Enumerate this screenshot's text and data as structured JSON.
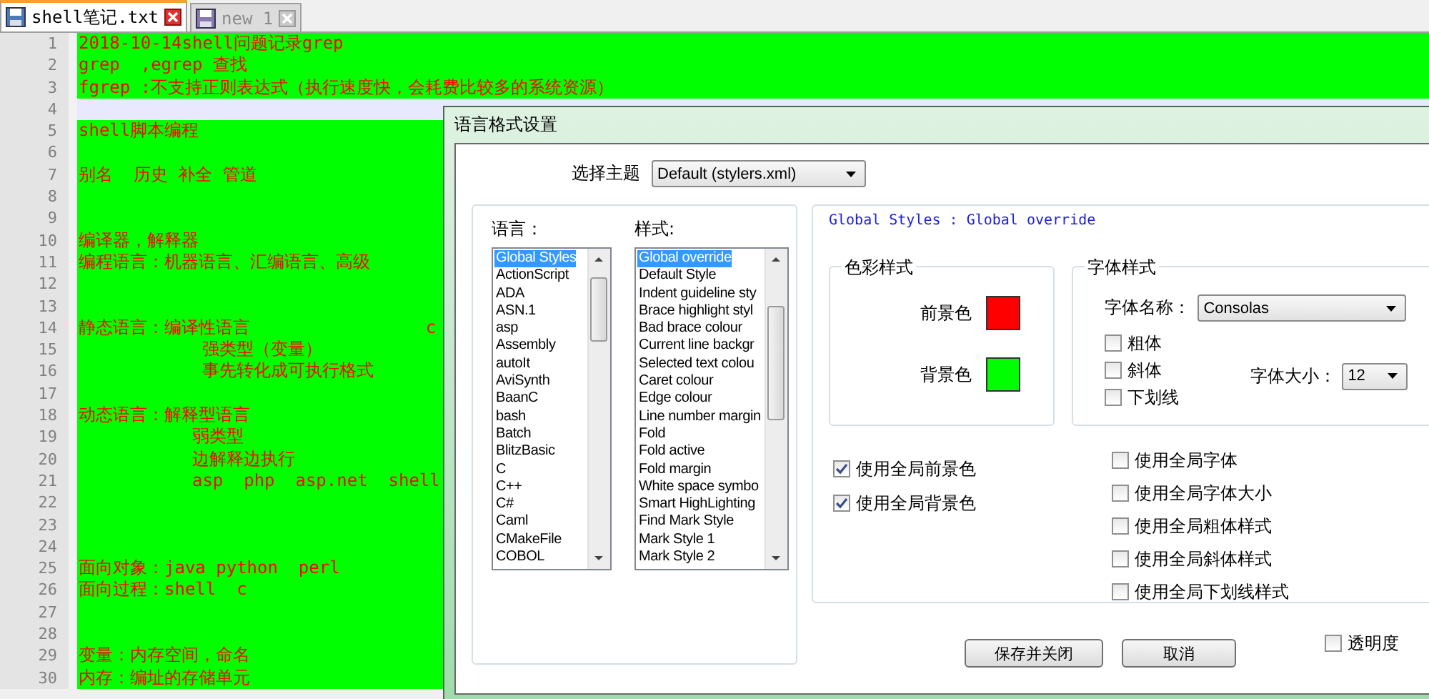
{
  "editor": {
    "tabs": [
      {
        "label": "shell笔记.txt",
        "selected": true
      },
      {
        "label": "new 1",
        "selected": false
      }
    ],
    "lines": [
      {
        "number": "1",
        "text": "2018-10-14shell问题记录grep",
        "current": false
      },
      {
        "number": "2",
        "text": "grep  ,egrep 查找",
        "current": false
      },
      {
        "number": "3",
        "text": "fgrep :不支持正则表达式（执行速度快，会耗费比较多的系统资源）",
        "current": false
      },
      {
        "number": "4",
        "current": true
      },
      {
        "number": "5",
        "text": "shell脚本编程",
        "current": false
      },
      {
        "number": "6",
        "current": false
      },
      {
        "number": "7",
        "text": "别名  历史 补全 管道",
        "current": false
      },
      {
        "number": "8",
        "current": false
      },
      {
        "number": "9",
        "current": false
      },
      {
        "number": "10",
        "text": "编译器，解释器",
        "current": false
      },
      {
        "number": "11",
        "text": "编程语言：机器语言、汇编语言、高级",
        "current": false
      },
      {
        "number": "12",
        "current": false
      },
      {
        "number": "13",
        "current": false
      },
      {
        "number": "14",
        "text": "静态语言：编译性语言                 c",
        "current": false
      },
      {
        "number": "15",
        "text": "            强类型（变量）",
        "current": false
      },
      {
        "number": "16",
        "text": "            事先转化成可执行格式",
        "current": false
      },
      {
        "number": "17",
        "current": false
      },
      {
        "number": "18",
        "text": "动态语言：解释型语言",
        "current": false
      },
      {
        "number": "19",
        "text": "           弱类型",
        "current": false
      },
      {
        "number": "20",
        "text": "           边解释边执行",
        "current": false
      },
      {
        "number": "21",
        "text": "           asp  php  asp.net  shell",
        "current": false
      },
      {
        "number": "22",
        "current": false
      },
      {
        "number": "23",
        "current": false
      },
      {
        "number": "24",
        "current": false
      },
      {
        "number": "25",
        "text": "面向对象：java python  perl",
        "current": false
      },
      {
        "number": "26",
        "text": "面向过程：shell  c",
        "current": false
      },
      {
        "number": "27",
        "current": false
      },
      {
        "number": "28",
        "current": false
      },
      {
        "number": "29",
        "text": "变量：内存空间，命名",
        "current": false
      },
      {
        "number": "30",
        "text": "内存：编址的存储单元",
        "current": false
      }
    ]
  },
  "dialog": {
    "title": "语言格式设置",
    "theme": {
      "label": "选择主题",
      "value": "Default (stylers.xml)"
    },
    "languages": {
      "label": "语言：",
      "items": [
        {
          "label": "Global Styles",
          "selected": true
        },
        {
          "label": "ActionScript",
          "selected": false
        },
        {
          "label": "ADA",
          "selected": false
        },
        {
          "label": "ASN.1",
          "selected": false
        },
        {
          "label": "asp",
          "selected": false
        },
        {
          "label": "Assembly",
          "selected": false
        },
        {
          "label": "autoIt",
          "selected": false
        },
        {
          "label": "AviSynth",
          "selected": false
        },
        {
          "label": "BaanC",
          "selected": false
        },
        {
          "label": "bash",
          "selected": false
        },
        {
          "label": "Batch",
          "selected": false
        },
        {
          "label": "BlitzBasic",
          "selected": false
        },
        {
          "label": "C",
          "selected": false
        },
        {
          "label": "C++",
          "selected": false
        },
        {
          "label": "C#",
          "selected": false
        },
        {
          "label": "Caml",
          "selected": false
        },
        {
          "label": "CMakeFile",
          "selected": false
        },
        {
          "label": "COBOL",
          "selected": false
        }
      ]
    },
    "styles": {
      "label": "样式:",
      "items": [
        {
          "label": "Global override",
          "selected": true
        },
        {
          "label": "Default Style",
          "selected": false
        },
        {
          "label": "Indent guideline sty",
          "selected": false
        },
        {
          "label": "Brace highlight styl",
          "selected": false
        },
        {
          "label": "Bad brace colour",
          "selected": false
        },
        {
          "label": "Current line backgr",
          "selected": false
        },
        {
          "label": "Selected text colou",
          "selected": false
        },
        {
          "label": "Caret colour",
          "selected": false
        },
        {
          "label": "Edge colour",
          "selected": false
        },
        {
          "label": "Line number margin",
          "selected": false
        },
        {
          "label": "Fold",
          "selected": false
        },
        {
          "label": "Fold active",
          "selected": false
        },
        {
          "label": "Fold margin",
          "selected": false
        },
        {
          "label": "White space symbo",
          "selected": false
        },
        {
          "label": "Smart HighLighting",
          "selected": false
        },
        {
          "label": "Find Mark Style",
          "selected": false
        },
        {
          "label": "Mark Style 1",
          "selected": false
        },
        {
          "label": "Mark Style 2",
          "selected": false
        }
      ]
    },
    "style_heading": "Global Styles : Global override",
    "color_style": {
      "title": "色彩样式",
      "swatches": [
        {
          "label": "前景色",
          "color": "#ff0000"
        },
        {
          "label": "背景色",
          "color": "#00ff00"
        }
      ]
    },
    "font_style": {
      "title": "字体样式",
      "font_name": {
        "label": "字体名称：",
        "value": "Consolas"
      },
      "options": [
        {
          "label": "粗体",
          "checked": false
        },
        {
          "label": "斜体",
          "checked": false
        },
        {
          "label": "下划线",
          "checked": false
        }
      ],
      "font_size": {
        "label": "字体大小：",
        "value": "12"
      }
    },
    "global_color_options": [
      {
        "label": "使用全局前景色",
        "checked": true
      },
      {
        "label": "使用全局背景色",
        "checked": true
      }
    ],
    "global_font_options": [
      {
        "label": "使用全局字体",
        "checked": false
      },
      {
        "label": "使用全局字体大小",
        "checked": false
      },
      {
        "label": "使用全局粗体样式",
        "checked": false
      },
      {
        "label": "使用全局斜体样式",
        "checked": false
      },
      {
        "label": "使用全局下划线样式",
        "checked": false
      }
    ],
    "buttons": [
      "保存并关闭",
      "取消"
    ],
    "transparency": {
      "label": "透明度",
      "checked": false
    }
  }
}
